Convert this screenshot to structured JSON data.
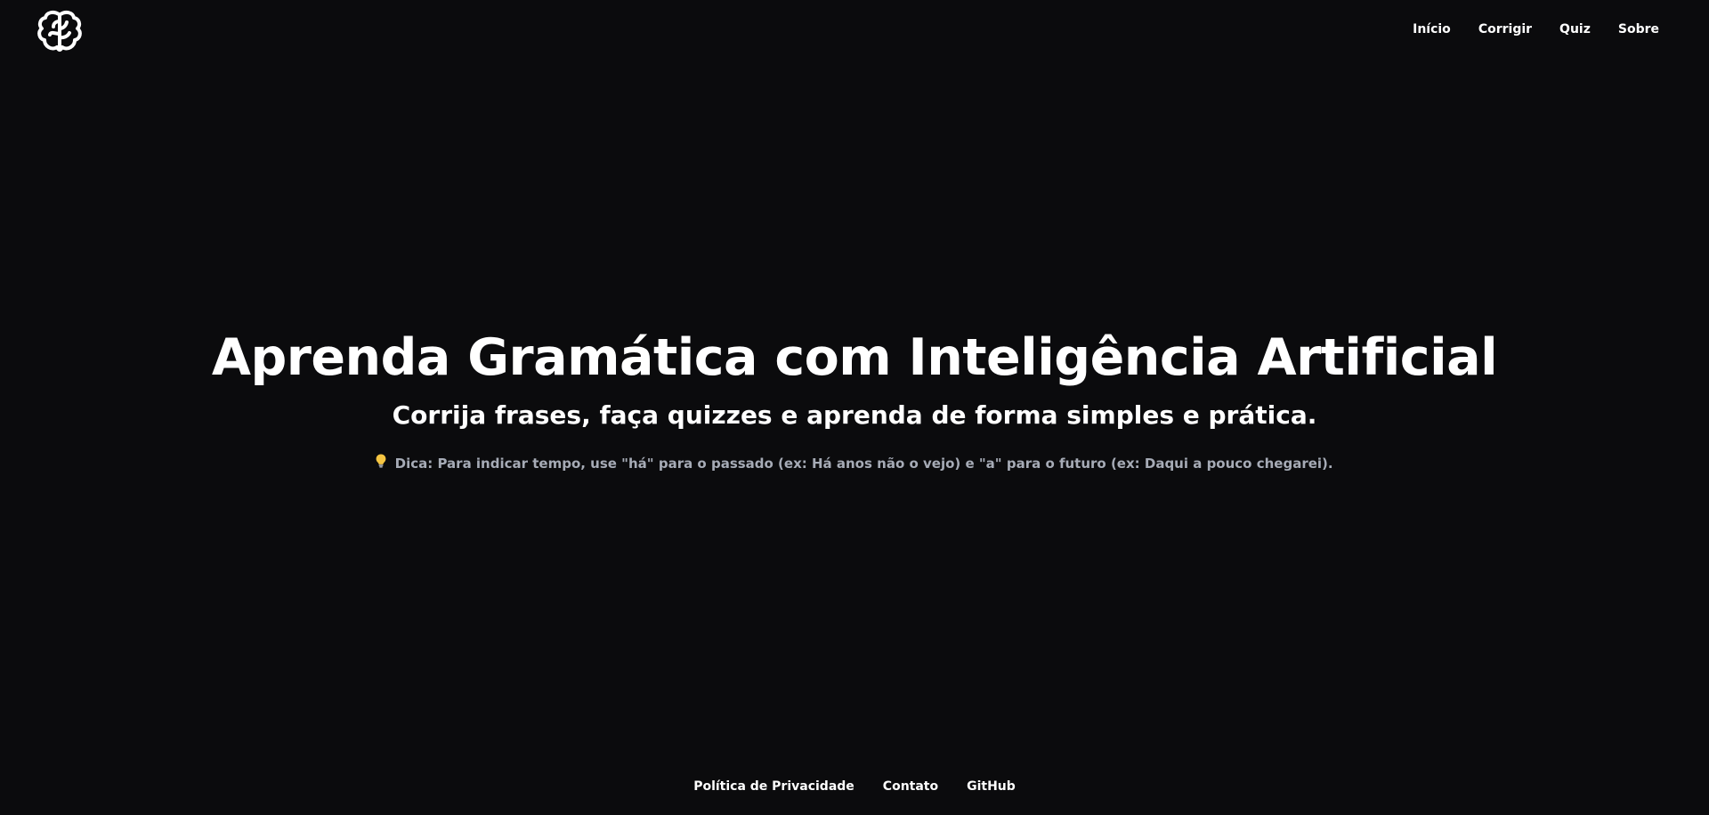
{
  "header": {
    "logo_icon": "brain-icon",
    "nav": {
      "home": "Início",
      "correct": "Corrigir",
      "quiz": "Quiz",
      "about": "Sobre"
    }
  },
  "hero": {
    "title": "Aprenda Gramática com Inteligência Artificial",
    "subtitle": "Corrija frases, faça quizzes e aprenda de forma simples e prática.",
    "tip_icon": "lightbulb-icon",
    "tip_text": "Dica: Para indicar tempo, use \"há\" para o passado (ex: Há anos não o vejo) e \"a\" para o futuro (ex: Daqui a pouco chegarei)."
  },
  "footer": {
    "privacy": "Política de Privacidade",
    "contact": "Contato",
    "github": "GitHub"
  },
  "colors": {
    "background": "#0b0b0d",
    "text": "#ffffff",
    "muted_text": "#a6abb6",
    "tip_icon": "#f5c542"
  }
}
